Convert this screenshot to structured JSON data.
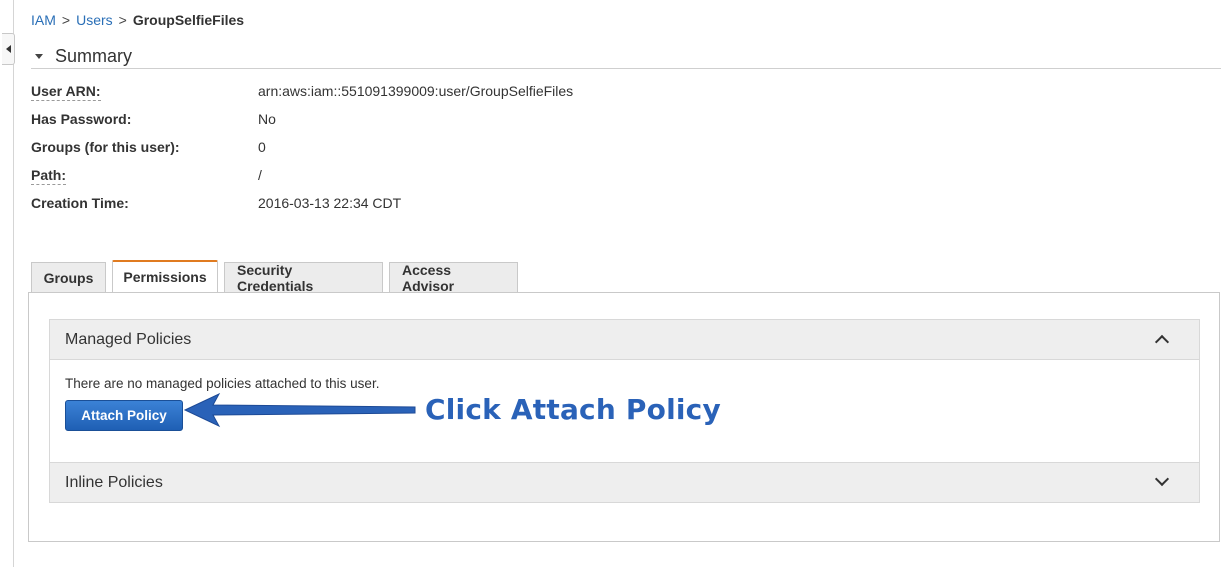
{
  "breadcrumb": {
    "root": "IAM",
    "separator": ">",
    "users": "Users",
    "current": "GroupSelfieFiles"
  },
  "summary": {
    "title": "Summary",
    "rows": [
      {
        "label": "User ARN:",
        "value": "arn:aws:iam::551091399009:user/GroupSelfieFiles"
      },
      {
        "label": "Has Password:",
        "value": "No"
      },
      {
        "label": "Groups (for this user):",
        "value": "0"
      },
      {
        "label": "Path:",
        "value": "/"
      },
      {
        "label": "Creation Time:",
        "value": "2016-03-13 22:34 CDT"
      }
    ]
  },
  "tabs": [
    {
      "label": "Groups",
      "active": false
    },
    {
      "label": "Permissions",
      "active": true
    },
    {
      "label": "Security Credentials",
      "active": false
    },
    {
      "label": "Access Advisor",
      "active": false
    }
  ],
  "managed_policies": {
    "title": "Managed Policies",
    "empty_message": "There are no managed policies attached to this user.",
    "attach_button": "Attach Policy"
  },
  "inline_policies": {
    "title": "Inline Policies"
  },
  "annotation": {
    "text": "Click Attach Policy",
    "color": "#2a62b8"
  },
  "colors": {
    "link": "#2a6fb7",
    "active_tab_accent": "#e07b20",
    "button": "#1f5fb4"
  }
}
